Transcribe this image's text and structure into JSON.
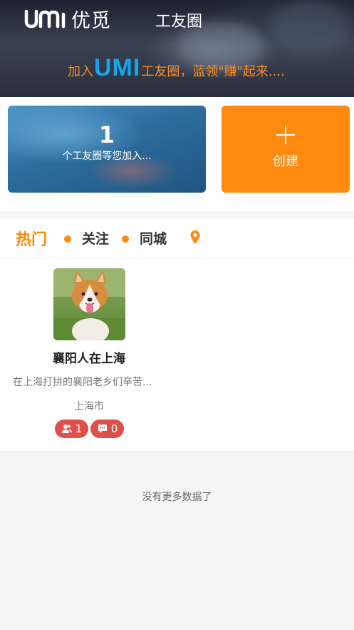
{
  "header": {
    "logo_text": "umi",
    "logo_cn": "优觅",
    "title": "工友圈",
    "slogan_prefix": "加入",
    "slogan_brand": "UMI",
    "slogan_suffix": "工友圈，蓝领\"赚\"起来...."
  },
  "cards": {
    "join": {
      "count": "1",
      "desc": "个工友圈等您加入..."
    },
    "create": {
      "label": "创建",
      "icon": "plus-icon"
    }
  },
  "tabs": [
    {
      "label": "热门",
      "active": true
    },
    {
      "label": "关注",
      "active": false
    },
    {
      "label": "同城",
      "active": false
    }
  ],
  "location_icon": "map-pin-icon",
  "groups": [
    {
      "name": "襄阳人在上海",
      "desc": "在上海打拼的襄阳老乡们辛苦...",
      "city": "上海市",
      "members": "1",
      "comments": "0"
    }
  ],
  "footer": {
    "no_more": "没有更多数据了"
  },
  "colors": {
    "accent": "#ff8a0d",
    "brand_blue": "#16a6e8",
    "badge_red": "#e0504b"
  }
}
